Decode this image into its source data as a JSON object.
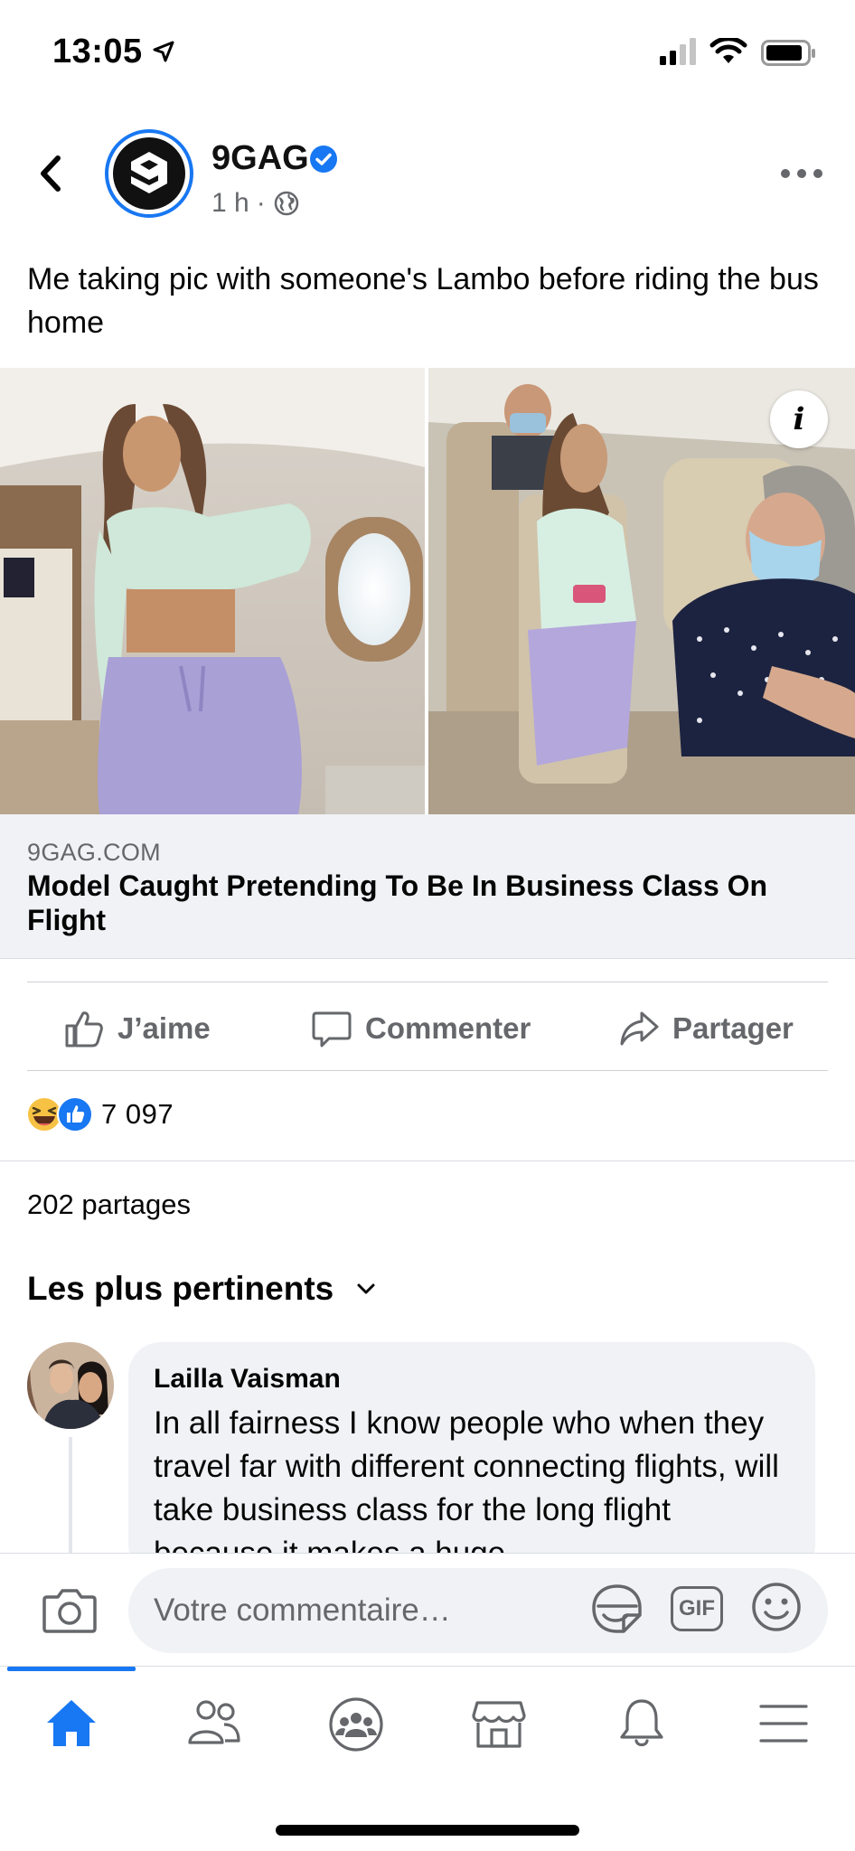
{
  "status_bar": {
    "time": "13:05"
  },
  "post": {
    "page_name": "9GAG",
    "meta_time": "1 h",
    "meta_sep": "·",
    "text": "Me taking pic with someone's Lambo before riding the bus home",
    "link": {
      "domain": "9GAG.COM",
      "title": "Model Caught Pretending To Be In Business Class On Flight"
    },
    "info_label": "i"
  },
  "actions": {
    "like": "J’aime",
    "comment": "Commenter",
    "share": "Partager"
  },
  "reactions": {
    "count": "7 097"
  },
  "shares": "202 partages",
  "comments_sort": "Les plus pertinents",
  "comment": {
    "author": "Lailla Vaisman",
    "text": "In all fairness I know people who when they travel far with different connecting flights, will take business class for the long flight because it makes a huge"
  },
  "composer": {
    "placeholder": "Votre commentaire…",
    "gif_label": "GIF"
  },
  "colors": {
    "accent": "#1877f2",
    "muted": "#65676b",
    "bubble": "#f0f2f5"
  }
}
